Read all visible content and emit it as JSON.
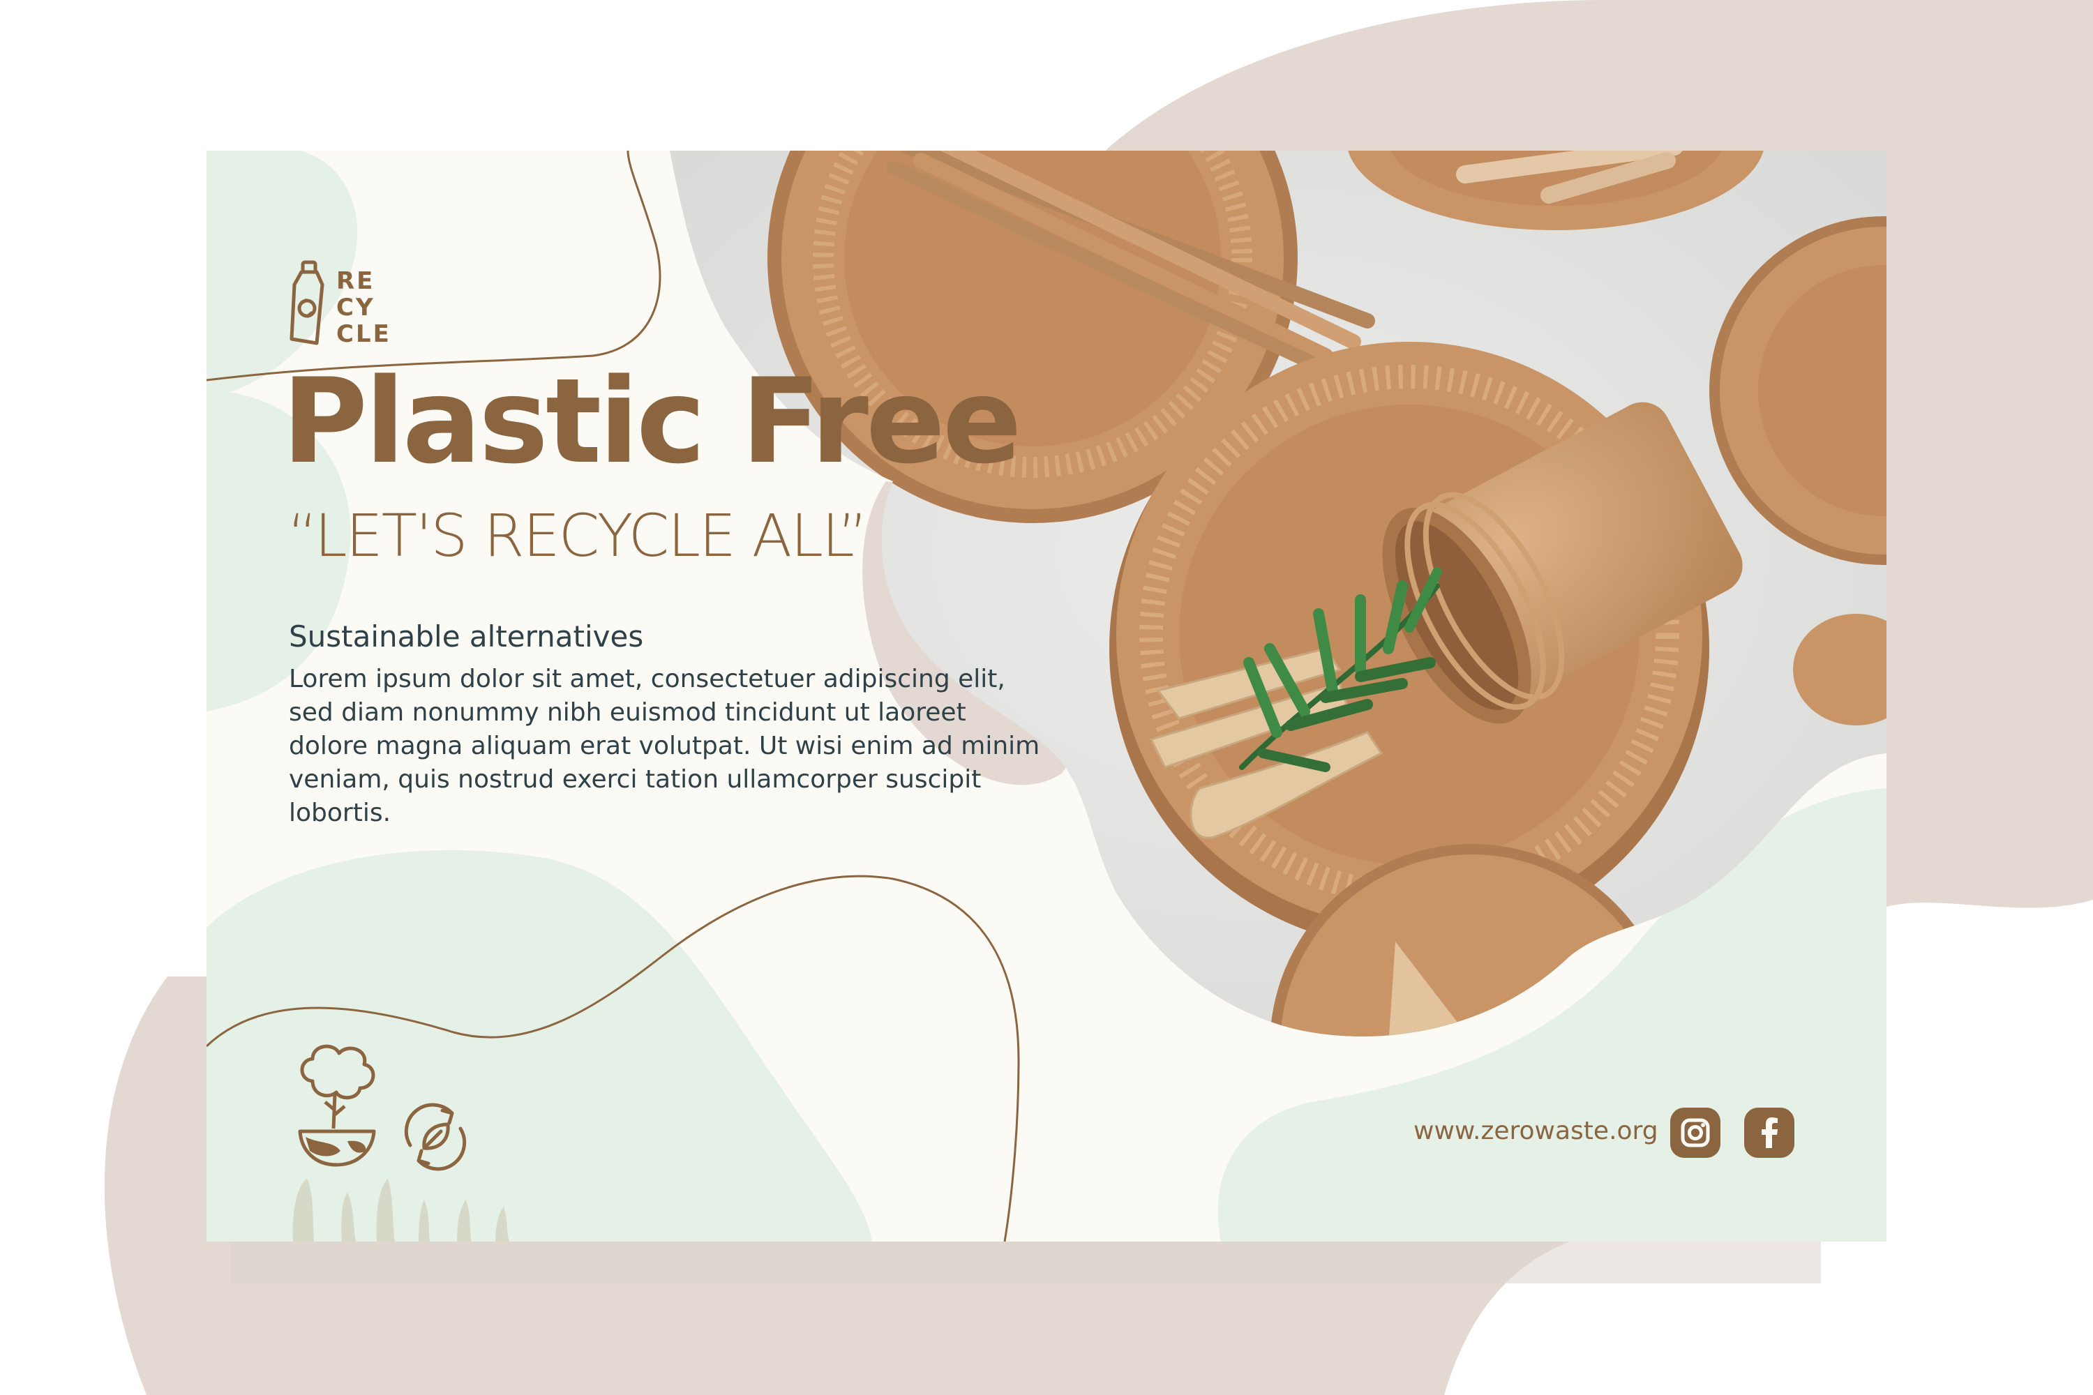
{
  "brand_word": [
    "RE",
    "CY",
    "CLE"
  ],
  "headline": "Plastic Free",
  "tagline": "“LET'S RECYCLE ALL”",
  "section_heading": "Sustainable alternatives",
  "body_text": "Lorem ipsum dolor sit amet, consectetuer adipiscing elit, sed diam nonummy nibh euismod tincidunt ut laoreet dolore magna aliquam erat volutpat. Ut wisi enim ad minim veniam, quis nostrud exerci tation ullamcorper suscipit lobortis.",
  "website": "www.zerowaste.org",
  "icons": {
    "bottle": "recycle-bottle-icon",
    "tree": "tree-globe-icon",
    "leaf_cycle": "leaf-recycle-icon",
    "instagram": "instagram-icon",
    "facebook": "facebook-icon"
  },
  "colors": {
    "brown": "#8b6540",
    "mint": "#e5f0e6",
    "cream": "#fbfaf4",
    "taupe": "#e3d9d2",
    "text_dark": "#2f4148",
    "plate": "#c99466",
    "plate_dark": "#b07c52",
    "paper_table": "#e6e6e4"
  }
}
